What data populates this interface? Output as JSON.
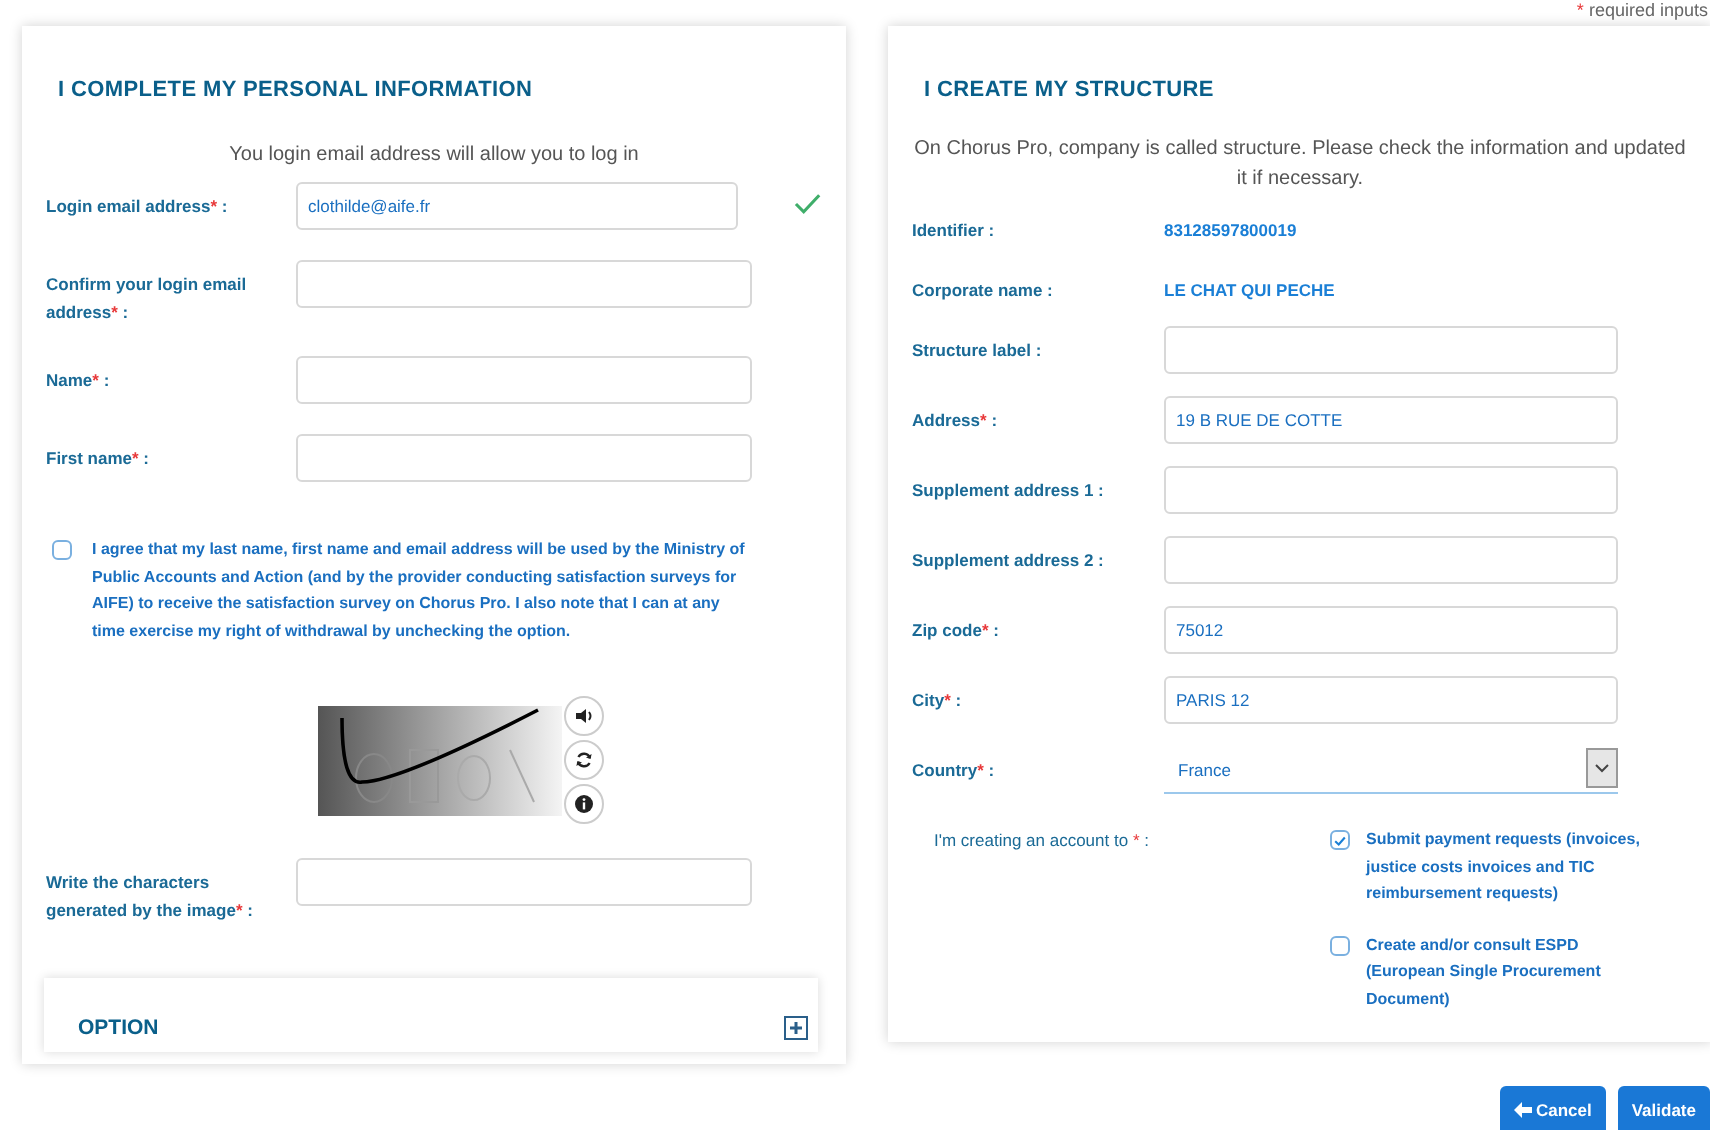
{
  "required_note": {
    "mark": "*",
    "text": "required inputs"
  },
  "personal": {
    "title": "I COMPLETE MY PERSONAL INFORMATION",
    "intro": "You login email address will allow you to log in",
    "fields": [
      {
        "label": "Login email address",
        "mark": "*",
        "tail": " :",
        "value": "clothilde@aife.fr",
        "valid": true
      },
      {
        "label": "Confirm your login email address",
        "mark": "*",
        "tail": " :"
      },
      {
        "label": "Name",
        "mark": "*",
        "tail": " :"
      },
      {
        "label": "First name",
        "mark": "*",
        "tail": " :"
      }
    ],
    "consent": {
      "checked": false,
      "text": "I agree that my last name, first name and email address will be used by the Ministry of Public Accounts and Action (and by the provider conducting satisfaction surveys for AIFE) to receive the satisfaction survey on Chorus Pro. I also note that I can at any time exercise my right of withdrawal by unchecking the option."
    },
    "captcha_field": {
      "label": "Write the characters generated by the image",
      "mark": "*",
      "tail": " :"
    },
    "option": {
      "title": "OPTION",
      "expanded": false
    }
  },
  "structure": {
    "title": "I CREATE MY STRUCTURE",
    "intro": "On Chorus Pro, company is called structure. Please check the information and updated it if necessary.",
    "rows": [
      {
        "kind": "static",
        "label": "Identifier :",
        "value": "83128597800019"
      },
      {
        "kind": "static",
        "label": "Corporate name :",
        "value": "LE CHAT QUI PECHE"
      },
      {
        "kind": "input",
        "label": "Structure label :"
      },
      {
        "kind": "input",
        "label": "Address",
        "mark": "*",
        "tail": " :",
        "value": "19 B RUE DE COTTE"
      },
      {
        "kind": "input",
        "label": "Supplement address 1 :"
      },
      {
        "kind": "input",
        "label": "Supplement address 2 :"
      },
      {
        "kind": "input",
        "label": "Zip code",
        "mark": "*",
        "tail": " :",
        "value": "75012"
      },
      {
        "kind": "input",
        "label": "City",
        "mark": "*",
        "tail": " :",
        "value": "PARIS 12"
      },
      {
        "kind": "select",
        "label": "Country",
        "mark": "*",
        "tail": " :",
        "value": "France"
      }
    ],
    "account": {
      "label": "I'm creating an account to",
      "mark": "*",
      "tail": " :",
      "options": [
        {
          "text": "Submit payment requests (invoices, justice costs invoices and TIC reimbursement requests)",
          "checked": true
        },
        {
          "text": "Create and/or consult ESPD (European Single Procurement Document)",
          "checked": false
        }
      ]
    }
  },
  "buttons": [
    {
      "kind": "back",
      "label": "Cancel"
    },
    {
      "kind": "primary",
      "label": "Validate"
    }
  ]
}
